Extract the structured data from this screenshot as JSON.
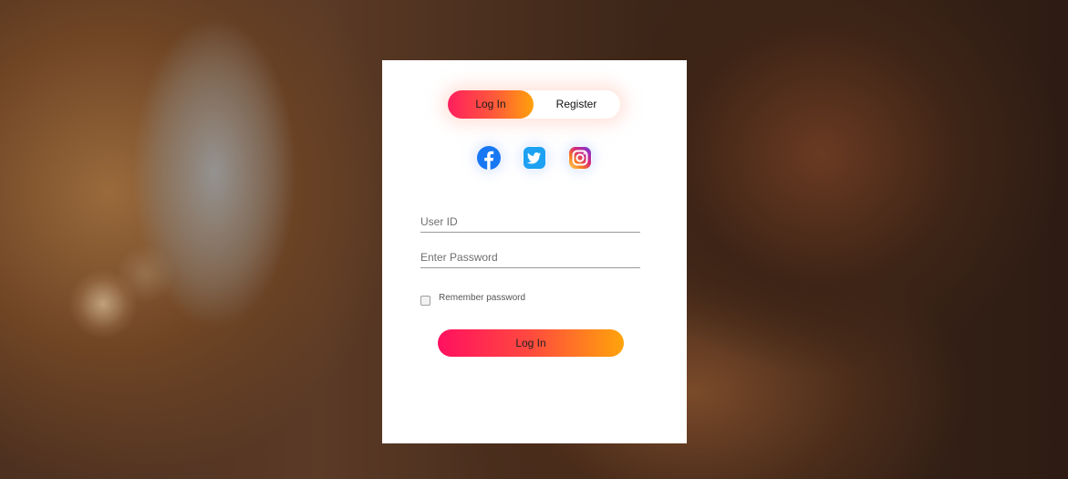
{
  "tabs": {
    "login_label": "Log In",
    "register_label": "Register",
    "active": "login"
  },
  "social": [
    {
      "name": "facebook",
      "icon": "facebook-icon",
      "color": "#1877F2"
    },
    {
      "name": "twitter",
      "icon": "twitter-icon",
      "color": "#1DA1F2"
    },
    {
      "name": "instagram",
      "icon": "instagram-icon",
      "color": "#E1306C"
    }
  ],
  "form": {
    "user_placeholder": "User ID",
    "user_value": "",
    "password_placeholder": "Enter Password",
    "password_value": "",
    "remember_label": "Remember password",
    "remember_checked": false,
    "submit_label": "Log In"
  },
  "colors": {
    "gradient_start": "#ff1060",
    "gradient_end": "#ffa40a",
    "card_background": "#ffffff"
  }
}
